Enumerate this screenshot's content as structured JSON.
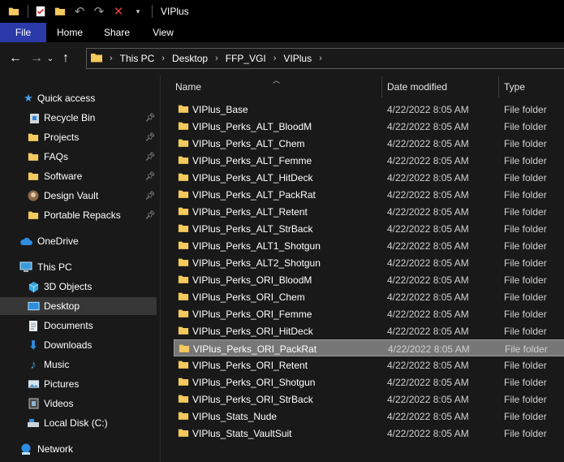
{
  "window": {
    "title": "VIPlus"
  },
  "ribbon": {
    "tabs": [
      "File",
      "Home",
      "Share",
      "View"
    ]
  },
  "address": {
    "crumbs": [
      "This PC",
      "Desktop",
      "FFP_VGI",
      "VIPlus"
    ]
  },
  "columns": {
    "name": "Name",
    "date": "Date modified",
    "type": "Type"
  },
  "nav": {
    "quick_access": "Quick access",
    "pinned": [
      "Recycle Bin",
      "Projects",
      "FAQs",
      "Software",
      "Design Vault",
      "Portable Repacks"
    ],
    "onedrive": "OneDrive",
    "this_pc": "This PC",
    "pc_items": [
      "3D Objects",
      "Desktop",
      "Documents",
      "Downloads",
      "Music",
      "Pictures",
      "Videos",
      "Local Disk (C:)"
    ],
    "network": "Network"
  },
  "files": [
    {
      "name": "VIPlus_Base",
      "date": "4/22/2022 8:05 AM",
      "type": "File folder"
    },
    {
      "name": "VIPlus_Perks_ALT_BloodM",
      "date": "4/22/2022 8:05 AM",
      "type": "File folder"
    },
    {
      "name": "VIPlus_Perks_ALT_Chem",
      "date": "4/22/2022 8:05 AM",
      "type": "File folder"
    },
    {
      "name": "VIPlus_Perks_ALT_Femme",
      "date": "4/22/2022 8:05 AM",
      "type": "File folder"
    },
    {
      "name": "VIPlus_Perks_ALT_HitDeck",
      "date": "4/22/2022 8:05 AM",
      "type": "File folder"
    },
    {
      "name": "VIPlus_Perks_ALT_PackRat",
      "date": "4/22/2022 8:05 AM",
      "type": "File folder"
    },
    {
      "name": "VIPlus_Perks_ALT_Retent",
      "date": "4/22/2022 8:05 AM",
      "type": "File folder"
    },
    {
      "name": "VIPlus_Perks_ALT_StrBack",
      "date": "4/22/2022 8:05 AM",
      "type": "File folder"
    },
    {
      "name": "VIPlus_Perks_ALT1_Shotgun",
      "date": "4/22/2022 8:05 AM",
      "type": "File folder"
    },
    {
      "name": "VIPlus_Perks_ALT2_Shotgun",
      "date": "4/22/2022 8:05 AM",
      "type": "File folder"
    },
    {
      "name": "VIPlus_Perks_ORI_BloodM",
      "date": "4/22/2022 8:05 AM",
      "type": "File folder"
    },
    {
      "name": "VIPlus_Perks_ORI_Chem",
      "date": "4/22/2022 8:05 AM",
      "type": "File folder"
    },
    {
      "name": "VIPlus_Perks_ORI_Femme",
      "date": "4/22/2022 8:05 AM",
      "type": "File folder"
    },
    {
      "name": "VIPlus_Perks_ORI_HitDeck",
      "date": "4/22/2022 8:05 AM",
      "type": "File folder"
    },
    {
      "name": "VIPlus_Perks_ORI_PackRat",
      "date": "4/22/2022 8:05 AM",
      "type": "File folder"
    },
    {
      "name": "VIPlus_Perks_ORI_Retent",
      "date": "4/22/2022 8:05 AM",
      "type": "File folder"
    },
    {
      "name": "VIPlus_Perks_ORI_Shotgun",
      "date": "4/22/2022 8:05 AM",
      "type": "File folder"
    },
    {
      "name": "VIPlus_Perks_ORI_StrBack",
      "date": "4/22/2022 8:05 AM",
      "type": "File folder"
    },
    {
      "name": "VIPlus_Stats_Nude",
      "date": "4/22/2022 8:05 AM",
      "type": "File folder"
    },
    {
      "name": "VIPlus_Stats_VaultSuit",
      "date": "4/22/2022 8:05 AM",
      "type": "File folder"
    }
  ],
  "selected_file": "VIPlus_Perks_ORI_PackRat",
  "selected_nav": "Desktop",
  "colors": {
    "folder": "#f4c95d",
    "file_tab": "#2b3aa8",
    "selection": "#777777",
    "nav_selected": "#373737",
    "background": "#191919"
  }
}
